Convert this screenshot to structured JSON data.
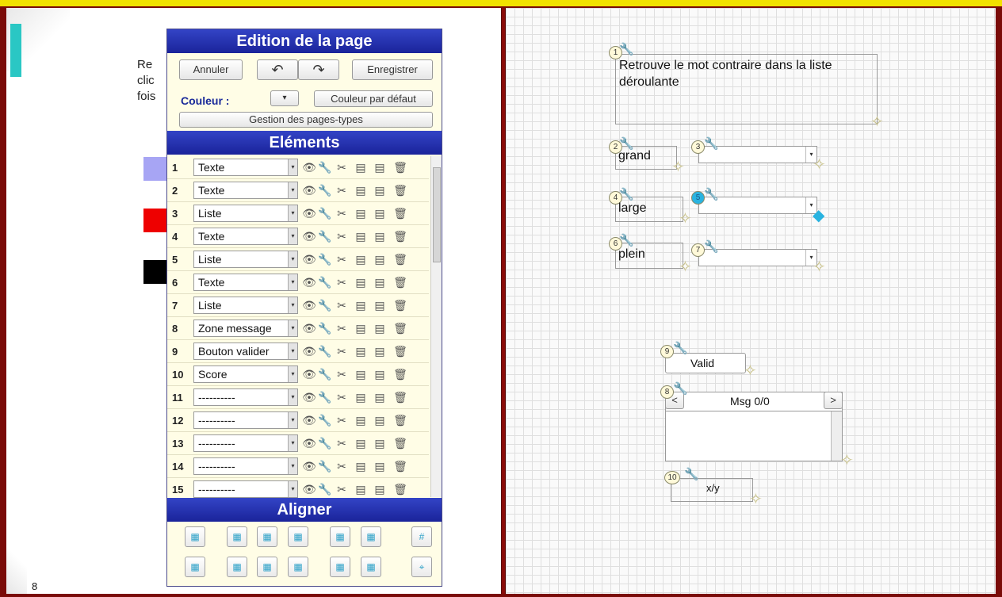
{
  "left_page": {
    "text_lines": [
      "Re",
      "clic",
      "fois"
    ],
    "page_number": "8",
    "swatch_colors": [
      "#a7a5f4",
      "#ee0000",
      "#000000"
    ]
  },
  "editor": {
    "title": "Edition de la page",
    "cancel_label": "Annuler",
    "undo_icon": "undo-icon",
    "redo_icon": "redo-icon",
    "save_label": "Enregistrer",
    "color_label": "Couleur :",
    "default_color_label": "Couleur par défaut",
    "templates_label": "Gestion des pages-types",
    "elements_title": "Eléments",
    "elements": [
      {
        "num": "1",
        "type": "Texte"
      },
      {
        "num": "2",
        "type": "Texte"
      },
      {
        "num": "3",
        "type": "Liste"
      },
      {
        "num": "4",
        "type": "Texte"
      },
      {
        "num": "5",
        "type": "Liste"
      },
      {
        "num": "6",
        "type": "Texte"
      },
      {
        "num": "7",
        "type": "Liste"
      },
      {
        "num": "8",
        "type": "Zone message"
      },
      {
        "num": "9",
        "type": "Bouton valider"
      },
      {
        "num": "10",
        "type": "Score"
      },
      {
        "num": "11",
        "type": "----------"
      },
      {
        "num": "12",
        "type": "----------"
      },
      {
        "num": "13",
        "type": "----------"
      },
      {
        "num": "14",
        "type": "----------"
      },
      {
        "num": "15",
        "type": "----------"
      }
    ],
    "align_title": "Aligner"
  },
  "canvas": {
    "instruction": "Retrouve le mot contraire dans la liste déroulante",
    "word1": "grand",
    "word2": "large",
    "word3": "plein",
    "valid_label": "Valid",
    "msg_label": "Msg 0/0",
    "prev_label": "<",
    "next_label": ">",
    "score_label": "x/y",
    "badges": [
      "1",
      "2",
      "3",
      "4",
      "5",
      "6",
      "7",
      "8",
      "9",
      "10"
    ]
  }
}
